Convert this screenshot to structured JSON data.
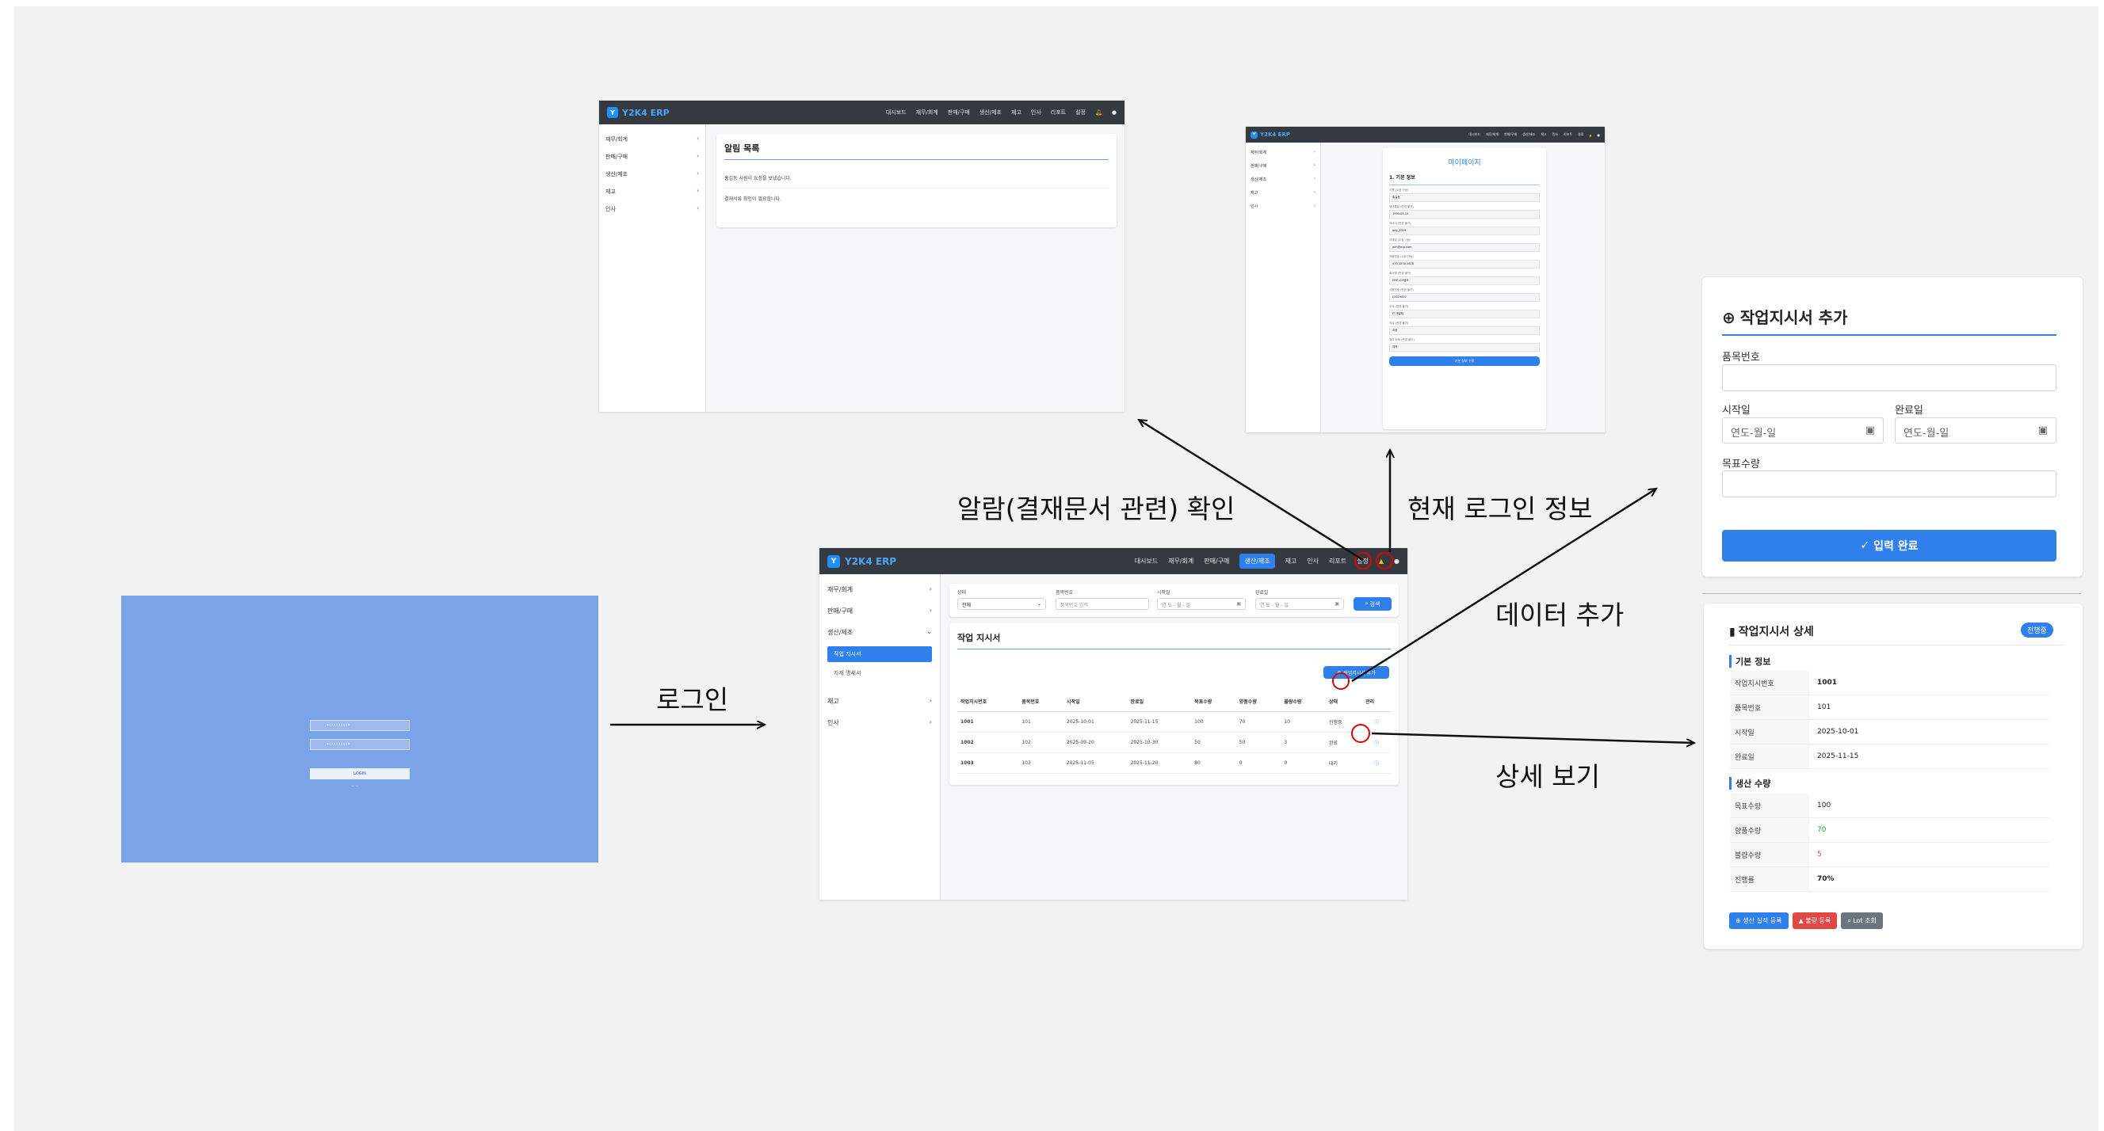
{
  "labels": {
    "login": "로그인",
    "alarm": "알람(결재문서 관련) 확인",
    "login_info": "현재 로그인 정보",
    "add_data": "데이터 추가",
    "detail_view": "상세 보기"
  },
  "app": {
    "brand": "Y2K4 ERP",
    "nav": [
      "대시보드",
      "재무/회계",
      "판매/구매",
      "생산/제조",
      "재고",
      "인사",
      "리포트",
      "설정"
    ],
    "active_nav": "생산/제조",
    "sidebar": [
      "재무/회계",
      "판매/구매",
      "생산/제조",
      "재고",
      "인사"
    ],
    "sidebar_sub": [
      "작업 지시서",
      "자재 명세서"
    ]
  },
  "login_screen": {
    "button": "LOGIN",
    "id_placeholder": "••••••••••",
    "pw_placeholder": "••••••••••",
    "footer": "— —"
  },
  "alarm_screen": {
    "title": "알림 목록",
    "items": [
      "홍길동 사원이 요청을 보냈습니다.",
      "결재서류 확인이 필요합니다."
    ]
  },
  "mypage_screen": {
    "title": "마이페이지",
    "section": "1. 기본 정보",
    "fields": [
      {
        "label": "이름 (수정 가능)",
        "value": "홍길동"
      },
      {
        "label": "생년월일 (변경 불가)",
        "value": "1990-05-15"
      },
      {
        "label": "아이디 (변경 불가)",
        "value": "gdy_2019"
      },
      {
        "label": "이메일 (수정 가능)",
        "value": "gdh@erp.com"
      },
      {
        "label": "전화번호 (수정 가능)",
        "value": "010-1234-5678"
      },
      {
        "label": "회사명 (변경 불가)",
        "value": "ERP 시스템즈"
      },
      {
        "label": "사원번호 (변경 불가)",
        "value": "E2019007"
      },
      {
        "label": "부서 (변경 불가)",
        "value": "IT 개발팀"
      },
      {
        "label": "직급 (변경 불가)",
        "value": "과장"
      },
      {
        "label": "재직 상태 (변경 불가)",
        "value": "재직"
      }
    ],
    "save_button": "기본 정보 수정"
  },
  "main_screen": {
    "filters": [
      {
        "label": "상태",
        "value": "전체"
      },
      {
        "label": "품목번호",
        "value": "품목번호 입력"
      },
      {
        "label": "시작일",
        "value": "연 도 - 월 - 일"
      },
      {
        "label": "완료일",
        "value": "연 도 - 월 - 일"
      }
    ],
    "search_button": "검색",
    "list_title": "작업 지시서",
    "add_button": "작업지시서 추가",
    "columns": [
      "작업지시번호",
      "품목번호",
      "시작일",
      "완료일",
      "목표수량",
      "양품수량",
      "불량수량",
      "상태",
      "관리"
    ],
    "rows": [
      [
        "1001",
        "101",
        "2025-10-01",
        "2025-11-15",
        "100",
        "70",
        "10",
        "진행중"
      ],
      [
        "1002",
        "102",
        "2025-09-20",
        "2025-10-30",
        "50",
        "50",
        "3",
        "완료"
      ],
      [
        "1003",
        "103",
        "2025-11-05",
        "2025-11-20",
        "80",
        "0",
        "0",
        "대기"
      ]
    ]
  },
  "add_form": {
    "title": "작업지시서 추가",
    "item_no_label": "품목번호",
    "start_label": "시작일",
    "end_label": "완료일",
    "date_placeholder": "연도-월-일",
    "qty_label": "목표수량",
    "submit": "입력 완료"
  },
  "detail_panel": {
    "title": "작업지시서 상세",
    "badge": "진행중",
    "section1": "기본 정보",
    "basic": [
      {
        "k": "작업지시번호",
        "v": "1001"
      },
      {
        "k": "품목번호",
        "v": "101"
      },
      {
        "k": "시작일",
        "v": "2025-10-01"
      },
      {
        "k": "완료일",
        "v": "2025-11-15"
      }
    ],
    "section2": "생산 수량",
    "qty": [
      {
        "k": "목표수량",
        "v": "100"
      },
      {
        "k": "양품수량",
        "v": "70"
      },
      {
        "k": "불량수량",
        "v": "5"
      },
      {
        "k": "진행률",
        "v": "70%"
      }
    ],
    "buttons": [
      "생산 실적 등록",
      "불량 등록",
      "Lot 조회"
    ]
  },
  "colors": {
    "topbar": "#343a40",
    "primary": "#2f80ed",
    "login_bg": "#7ba3e8",
    "danger": "#e04848",
    "good": "#2e9e3c",
    "secondary": "#6c757d"
  }
}
